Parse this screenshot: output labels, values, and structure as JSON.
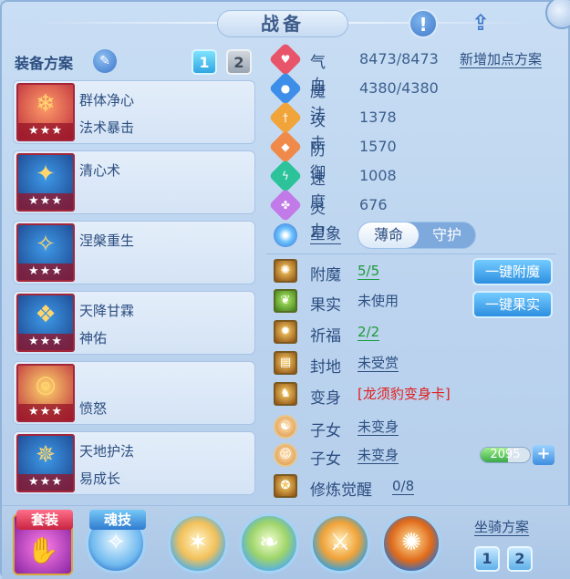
{
  "window": {
    "title": "战备",
    "info_icon": "info-icon",
    "share_icon": "share-icon"
  },
  "equipment": {
    "title": "装备方案",
    "edit_icon": "pen-icon",
    "schemes": [
      "1",
      "2"
    ],
    "active_scheme": "1",
    "slots": [
      {
        "line1": "群体净心",
        "line2": "法术暴击",
        "stars": "★★★",
        "icon": "ice-spear-icon"
      },
      {
        "line1": "清心术",
        "line2": "",
        "stars": "★★★",
        "icon": "flame-wings-icon"
      },
      {
        "line1": "涅槃重生",
        "line2": "",
        "stars": "★★★",
        "icon": "phoenix-icon"
      },
      {
        "line1": "天降甘霖",
        "line2": "神佑",
        "stars": "★★★",
        "icon": "blue-spirit-icon"
      },
      {
        "line1": "",
        "line2": "愤怒",
        "stars": "★★★",
        "icon": "golden-ring-icon"
      },
      {
        "line1": "天地护法",
        "line2": "易成长",
        "stars": "★★★",
        "icon": "guardian-icon"
      }
    ]
  },
  "stats": {
    "add_scheme_label": "新增加点方案",
    "rows": [
      {
        "label": "气血",
        "value": "8473/8473",
        "icon": "heart-icon",
        "color": "#e8556a"
      },
      {
        "label": "魔法",
        "value": "4380/4380",
        "icon": "mana-icon",
        "color": "#3d8ee8"
      },
      {
        "label": "攻击",
        "value": "1378",
        "icon": "sword-icon",
        "color": "#f0a43a"
      },
      {
        "label": "防御",
        "value": "1570",
        "icon": "shield-icon",
        "color": "#f08a4a"
      },
      {
        "label": "速度",
        "value": "1008",
        "icon": "speed-icon",
        "color": "#2cc39a"
      },
      {
        "label": "灵力",
        "value": "676",
        "icon": "spirit-icon",
        "color": "#c27ae8"
      }
    ]
  },
  "star_sign": {
    "label": "星象",
    "options": [
      "薄命",
      "守护"
    ],
    "selected": "薄命"
  },
  "features": [
    {
      "label": "附魔",
      "value": "5/5",
      "style": "green",
      "icon": "enchant-icon"
    },
    {
      "label": "果实",
      "value": "未使用",
      "style": "plain",
      "icon": "fruit-icon"
    },
    {
      "label": "祈福",
      "value": "2/2",
      "style": "green",
      "icon": "blessing-icon"
    },
    {
      "label": "封地",
      "value": "未受赏",
      "style": "link",
      "icon": "fief-icon"
    },
    {
      "label": "变身",
      "value": "[龙须豹变身卡]",
      "style": "red",
      "icon": "transform-icon"
    },
    {
      "label": "子女",
      "value": "未变身",
      "style": "link",
      "icon": "child-icon"
    },
    {
      "label": "子女",
      "value": "未变身",
      "style": "link",
      "icon": "child-icon"
    },
    {
      "label": "修炼觉醒",
      "value": "0/8",
      "style": "link",
      "icon": "cultivate-icon"
    }
  ],
  "actions": {
    "one_click_enchant": "一键附魔",
    "one_click_fruit": "一键果实"
  },
  "child_exp": {
    "value": "2095",
    "fill": 0.55,
    "plus_icon": "plus-icon"
  },
  "bottom": {
    "suit_label": "套装",
    "soul_skill_label": "魂技",
    "mount_scheme_label": "坐骑方案",
    "mount_schemes": [
      "1",
      "2"
    ],
    "skill_icons": [
      "soul-orb-icon",
      "dancer-icon",
      "wind-leaf-icon",
      "sword-arc-icon",
      "fire-burst-icon"
    ]
  }
}
